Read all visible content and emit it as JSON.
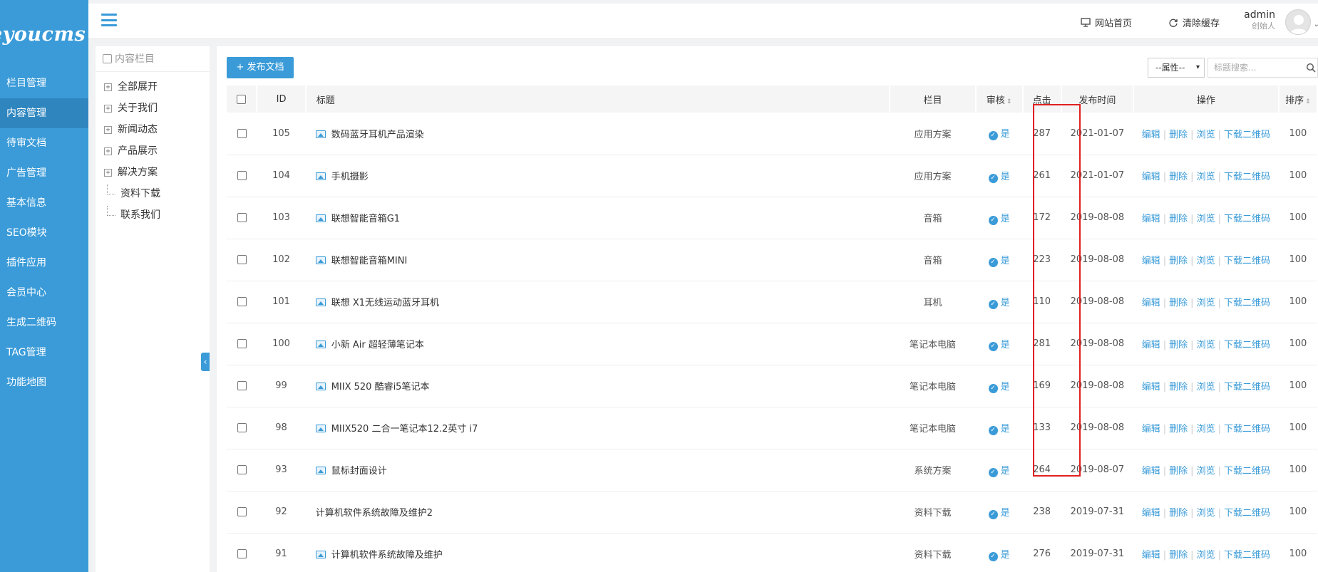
{
  "brand": {
    "logo_text": "eyoucms"
  },
  "sidebar": {
    "items": [
      {
        "label": "栏目管理",
        "active": false
      },
      {
        "label": "内容管理",
        "active": true
      },
      {
        "label": "待审文档",
        "active": false
      },
      {
        "label": "广告管理",
        "active": false
      },
      {
        "label": "基本信息",
        "active": false
      },
      {
        "label": "SEO模块",
        "active": false
      },
      {
        "label": "插件应用",
        "active": false
      },
      {
        "label": "会员中心",
        "active": false
      },
      {
        "label": "生成二维码",
        "active": false
      },
      {
        "label": "TAG管理",
        "active": false
      },
      {
        "label": "功能地图",
        "active": false
      }
    ]
  },
  "header": {
    "home_label": "网站首页",
    "clear_cache_label": "清除缓存",
    "user_name": "admin",
    "user_role": "创始人"
  },
  "tree": {
    "title": "内容栏目",
    "items": [
      {
        "label": "全部展开",
        "type": "plus"
      },
      {
        "label": "关于我们",
        "type": "plus"
      },
      {
        "label": "新闻动态",
        "type": "plus"
      },
      {
        "label": "产品展示",
        "type": "plus"
      },
      {
        "label": "解决方案",
        "type": "plus"
      },
      {
        "label": "资料下载",
        "type": "leaf"
      },
      {
        "label": "联系我们",
        "type": "leaf"
      }
    ]
  },
  "toolbar": {
    "add_label": "+ 发布文档",
    "attr_select": "--属性--",
    "search_placeholder": "标题搜索..."
  },
  "table": {
    "headers": {
      "id": "ID",
      "title": "标题",
      "column": "栏目",
      "audit": "审核",
      "clicks": "点击",
      "date": "发布时间",
      "ops": "操作",
      "sort": "排序"
    },
    "op_labels": {
      "edit": "编辑",
      "delete": "删除",
      "view": "浏览",
      "qrcode": "下载二维码"
    },
    "rows": [
      {
        "id": "105",
        "title": "数码蓝牙耳机产品渲染",
        "has_image": true,
        "column": "应用方案",
        "audit": "是",
        "clicks": "287",
        "date": "2021-01-07",
        "sort": "100"
      },
      {
        "id": "104",
        "title": "手机摄影",
        "has_image": true,
        "column": "应用方案",
        "audit": "是",
        "clicks": "261",
        "date": "2021-01-07",
        "sort": "100"
      },
      {
        "id": "103",
        "title": "联想智能音箱G1",
        "has_image": true,
        "column": "音箱",
        "audit": "是",
        "clicks": "172",
        "date": "2019-08-08",
        "sort": "100"
      },
      {
        "id": "102",
        "title": "联想智能音箱MINI",
        "has_image": true,
        "column": "音箱",
        "audit": "是",
        "clicks": "223",
        "date": "2019-08-08",
        "sort": "100"
      },
      {
        "id": "101",
        "title": "联想 X1无线运动蓝牙耳机",
        "has_image": true,
        "column": "耳机",
        "audit": "是",
        "clicks": "110",
        "date": "2019-08-08",
        "sort": "100"
      },
      {
        "id": "100",
        "title": "小新 Air 超轻薄笔记本",
        "has_image": true,
        "column": "笔记本电脑",
        "audit": "是",
        "clicks": "281",
        "date": "2019-08-08",
        "sort": "100"
      },
      {
        "id": "99",
        "title": "MIIX 520 酷睿i5笔记本",
        "has_image": true,
        "column": "笔记本电脑",
        "audit": "是",
        "clicks": "169",
        "date": "2019-08-08",
        "sort": "100"
      },
      {
        "id": "98",
        "title": "MIIX520 二合一笔记本12.2英寸 i7",
        "has_image": true,
        "column": "笔记本电脑",
        "audit": "是",
        "clicks": "133",
        "date": "2019-08-08",
        "sort": "100"
      },
      {
        "id": "93",
        "title": "鼠标封面设计",
        "has_image": true,
        "column": "系统方案",
        "audit": "是",
        "clicks": "264",
        "date": "2019-08-07",
        "sort": "100"
      },
      {
        "id": "92",
        "title": "计算机软件系统故障及维护2",
        "has_image": false,
        "column": "资料下载",
        "audit": "是",
        "clicks": "238",
        "date": "2019-07-31",
        "sort": "100"
      },
      {
        "id": "91",
        "title": "计算机软件系统故障及维护",
        "has_image": true,
        "column": "资料下载",
        "audit": "是",
        "clicks": "276",
        "date": "2019-07-31",
        "sort": "100"
      }
    ]
  },
  "colors": {
    "accent": "#3a9bd8",
    "highlight_box": "#e02020"
  }
}
